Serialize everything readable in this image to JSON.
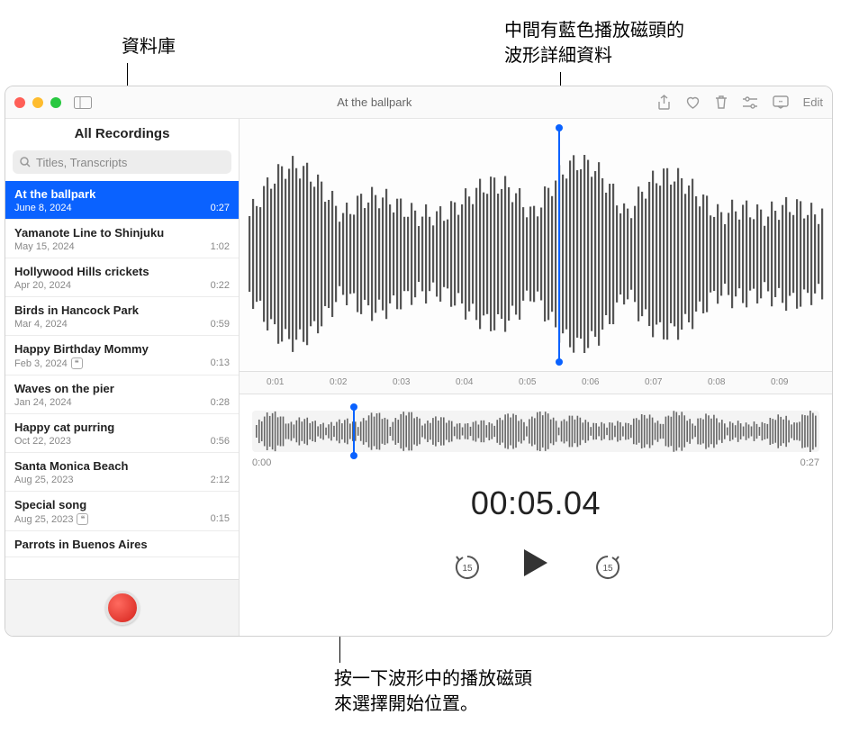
{
  "annotations": {
    "top_left": "資料庫",
    "top_right_l1": "中間有藍色播放磁頭的",
    "top_right_l2": "波形詳細資料",
    "bottom_l1": "按一下波形中的播放磁頭",
    "bottom_l2": "來選擇開始位置。"
  },
  "window": {
    "title": "At the ballpark",
    "edit_label": "Edit"
  },
  "sidebar": {
    "header": "All Recordings",
    "search_placeholder": "Titles, Transcripts",
    "items": [
      {
        "title": "At the ballpark",
        "date": "June 8, 2024",
        "duration": "0:27",
        "selected": true,
        "transcript": false
      },
      {
        "title": "Yamanote Line to Shinjuku",
        "date": "May 15, 2024",
        "duration": "1:02",
        "selected": false,
        "transcript": false
      },
      {
        "title": "Hollywood Hills crickets",
        "date": "Apr 20, 2024",
        "duration": "0:22",
        "selected": false,
        "transcript": false
      },
      {
        "title": "Birds in Hancock Park",
        "date": "Mar 4, 2024",
        "duration": "0:59",
        "selected": false,
        "transcript": false
      },
      {
        "title": "Happy Birthday Mommy",
        "date": "Feb 3, 2024",
        "duration": "0:13",
        "selected": false,
        "transcript": true
      },
      {
        "title": "Waves on the pier",
        "date": "Jan 24, 2024",
        "duration": "0:28",
        "selected": false,
        "transcript": false
      },
      {
        "title": "Happy cat purring",
        "date": "Oct 22, 2023",
        "duration": "0:56",
        "selected": false,
        "transcript": false
      },
      {
        "title": "Santa Monica Beach",
        "date": "Aug 25, 2023",
        "duration": "2:12",
        "selected": false,
        "transcript": false
      },
      {
        "title": "Special song",
        "date": "Aug 25, 2023",
        "duration": "0:15",
        "selected": false,
        "transcript": true
      },
      {
        "title": "Parrots in Buenos Aires",
        "date": "",
        "duration": "",
        "selected": false,
        "transcript": false
      }
    ]
  },
  "ruler": {
    "ticks": [
      "0:01",
      "0:02",
      "0:03",
      "0:04",
      "0:05",
      "0:06",
      "0:07",
      "0:08",
      "0:09"
    ]
  },
  "overview": {
    "start": "0:00",
    "end": "0:27"
  },
  "time_display": "00:05.04",
  "skip_seconds": "15"
}
